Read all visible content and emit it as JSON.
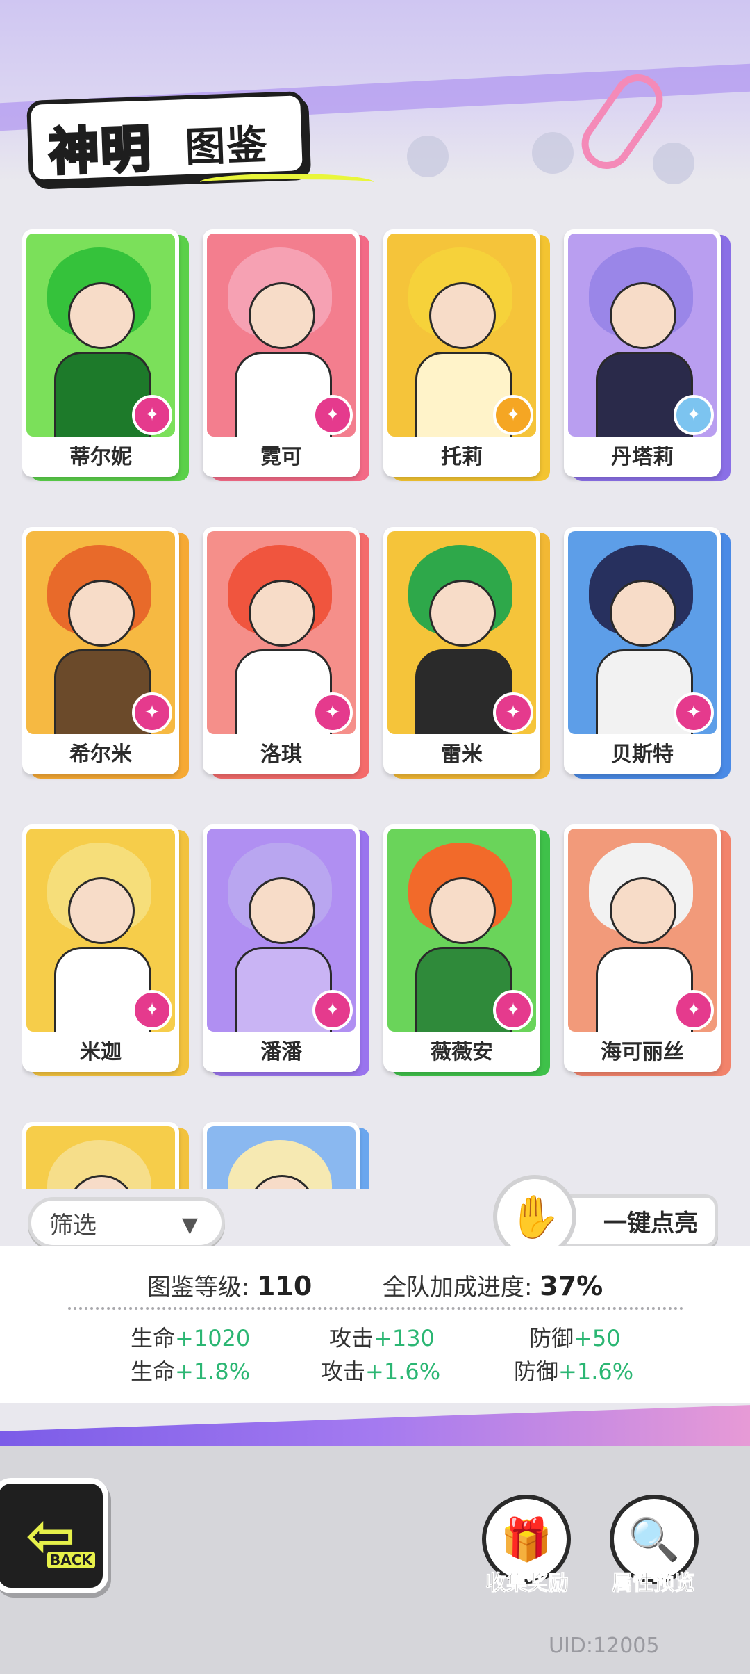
{
  "header": {
    "title_main": "神明",
    "title_sub": "图鉴"
  },
  "cards": [
    {
      "name": "蒂尔妮",
      "hair": "#35c23b",
      "bg": "#7be05a",
      "body": "#1d7a2a",
      "back": "#5bd04a",
      "emblem": "pink",
      "icon": "✦"
    },
    {
      "name": "霓可",
      "hair": "#f6a1b3",
      "bg": "#f37e8e",
      "body": "#ffffff",
      "back": "#f36a86",
      "emblem": "pink",
      "icon": "✦"
    },
    {
      "name": "托莉",
      "hair": "#f6d23a",
      "bg": "#f5c43a",
      "body": "#fff3c9",
      "back": "#f3c431",
      "emblem": "gold",
      "icon": "✦"
    },
    {
      "name": "丹塔莉",
      "hair": "#9a86e8",
      "bg": "#b99ef0",
      "body": "#2a2a4a",
      "back": "#8a6fe6",
      "emblem": "sky",
      "icon": "✦"
    },
    {
      "name": "希尔米",
      "hair": "#e86a2a",
      "bg": "#f6b942",
      "body": "#6b4a2a",
      "back": "#f6a934",
      "emblem": "pink",
      "icon": "✦"
    },
    {
      "name": "洛琪",
      "hair": "#f0553e",
      "bg": "#f58f8a",
      "body": "#ffffff",
      "back": "#f46b6b",
      "emblem": "pink",
      "icon": "✦"
    },
    {
      "name": "雷米",
      "hair": "#2ea84a",
      "bg": "#f5c43a",
      "body": "#2a2a2a",
      "back": "#f2b834",
      "emblem": "pink",
      "icon": "✦"
    },
    {
      "name": "贝斯特",
      "hair": "#27305e",
      "bg": "#5d9ee8",
      "body": "#f2f2f2",
      "back": "#4a8ae6",
      "emblem": "pink",
      "icon": "✦"
    },
    {
      "name": "米迦",
      "hair": "#f6de7a",
      "bg": "#f6cd4a",
      "body": "#ffffff",
      "back": "#f2c23e",
      "emblem": "pink",
      "icon": "✦"
    },
    {
      "name": "潘潘",
      "hair": "#b9a6f0",
      "bg": "#b08ff2",
      "body": "#c9b4f4",
      "back": "#9a74ee",
      "emblem": "pink",
      "icon": "✦"
    },
    {
      "name": "薇薇安",
      "hair": "#f26a2a",
      "bg": "#6ad45a",
      "body": "#2f8a3a",
      "back": "#3fc14a",
      "emblem": "pink",
      "icon": "✦"
    },
    {
      "name": "海可丽丝",
      "hair": "#f2f2f2",
      "bg": "#f29a7a",
      "body": "#ffffff",
      "back": "#f2836b",
      "emblem": "pink",
      "icon": "✦"
    },
    {
      "name": "",
      "hair": "#f6de8a",
      "bg": "#f6cd4a",
      "body": "#f6cd4a",
      "back": "#f2c23e",
      "emblem": "pink",
      "icon": ""
    },
    {
      "name": "",
      "hair": "#f6e9b2",
      "bg": "#8ab8f0",
      "body": "#8ab8f0",
      "back": "#6aa6ee",
      "emblem": "pink",
      "icon": ""
    }
  ],
  "filter": {
    "label": "筛选",
    "chevron": "▼"
  },
  "light_up": {
    "label": "一键点亮",
    "icon": "✋"
  },
  "stats": {
    "level_label": "图鉴等级:",
    "level_value": "110",
    "progress_label": "全队加成进度:",
    "progress_value": "37%",
    "rows": [
      [
        {
          "label": "生命",
          "value": "+1020"
        },
        {
          "label": "攻击",
          "value": "+130"
        },
        {
          "label": "防御",
          "value": "+50"
        }
      ],
      [
        {
          "label": "生命",
          "value": "+1.8%"
        },
        {
          "label": "攻击",
          "value": "+1.6%"
        },
        {
          "label": "防御",
          "value": "+1.6%"
        }
      ]
    ]
  },
  "footer": {
    "back_text": "BACK",
    "back_arrow": "⇦",
    "collect_label": "收集奖励",
    "collect_icon": "🎁",
    "preview_label": "属性预览",
    "preview_icon": "🔍",
    "uid": "UID:12005"
  }
}
